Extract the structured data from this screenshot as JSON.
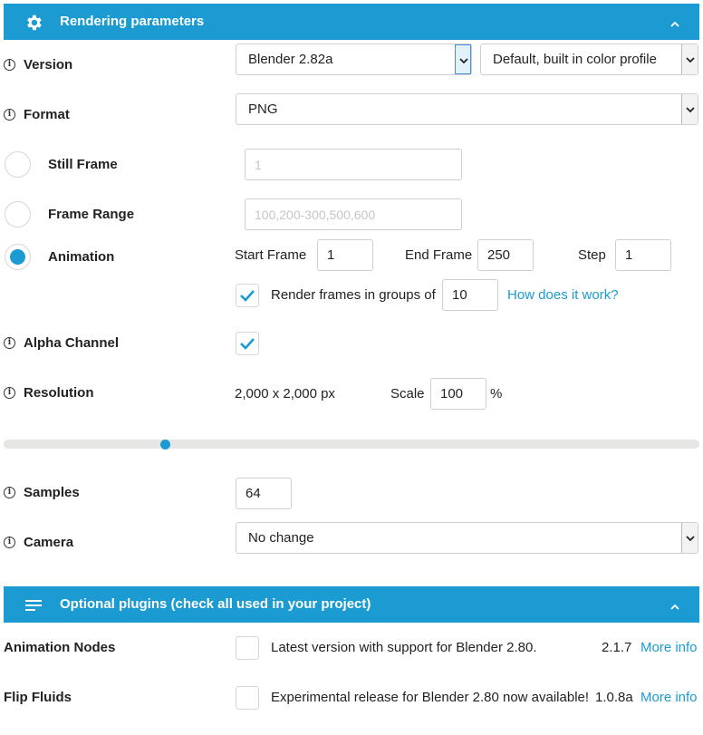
{
  "rendering": {
    "header_title": "Rendering parameters",
    "version": {
      "label": "Version",
      "selected": "Blender 2.82a",
      "profile": "Default, built in color profile"
    },
    "format": {
      "label": "Format",
      "selected": "PNG"
    },
    "still_frame": {
      "label": "Still Frame",
      "placeholder": "1",
      "selected": false
    },
    "frame_range": {
      "label": "Frame Range",
      "placeholder": "100,200-300,500,600",
      "selected": false
    },
    "animation": {
      "label": "Animation",
      "selected": true,
      "start_label": "Start Frame",
      "start_value": "1",
      "end_label": "End Frame",
      "end_value": "250",
      "step_label": "Step",
      "step_value": "1",
      "groups_checked": true,
      "groups_label": "Render frames in groups of",
      "groups_value": "10",
      "groups_link": "How does it work?"
    },
    "alpha": {
      "label": "Alpha Channel",
      "checked": true
    },
    "resolution": {
      "label": "Resolution",
      "value": "2,000 x 2,000 px",
      "scale_label": "Scale",
      "scale_value": "100",
      "scale_unit": "%",
      "slider_fraction": 0.23
    },
    "samples": {
      "label": "Samples",
      "value": "64"
    },
    "camera": {
      "label": "Camera",
      "selected": "No change"
    }
  },
  "plugins": {
    "header_title": "Optional plugins (check all used in your project)",
    "items": [
      {
        "name": "Animation Nodes",
        "checked": false,
        "description": "Latest version with support for Blender 2.80.",
        "version": "2.1.7",
        "link": "More info"
      },
      {
        "name": "Flip Fluids",
        "checked": false,
        "description": "Experimental release for Blender 2.80 now available!",
        "version": "1.0.8a",
        "link": "More info"
      }
    ]
  },
  "colors": {
    "accent": "#1b9bd1",
    "text": "#222222",
    "border": "#cfcfcf",
    "track": "#e6e6e4"
  },
  "icons": {
    "rendering_header": "gear-icon",
    "plugins_header": "menu-lines-icon",
    "collapse": "chevron-up-icon",
    "info": "info-icon",
    "check": "checkmark-icon"
  }
}
